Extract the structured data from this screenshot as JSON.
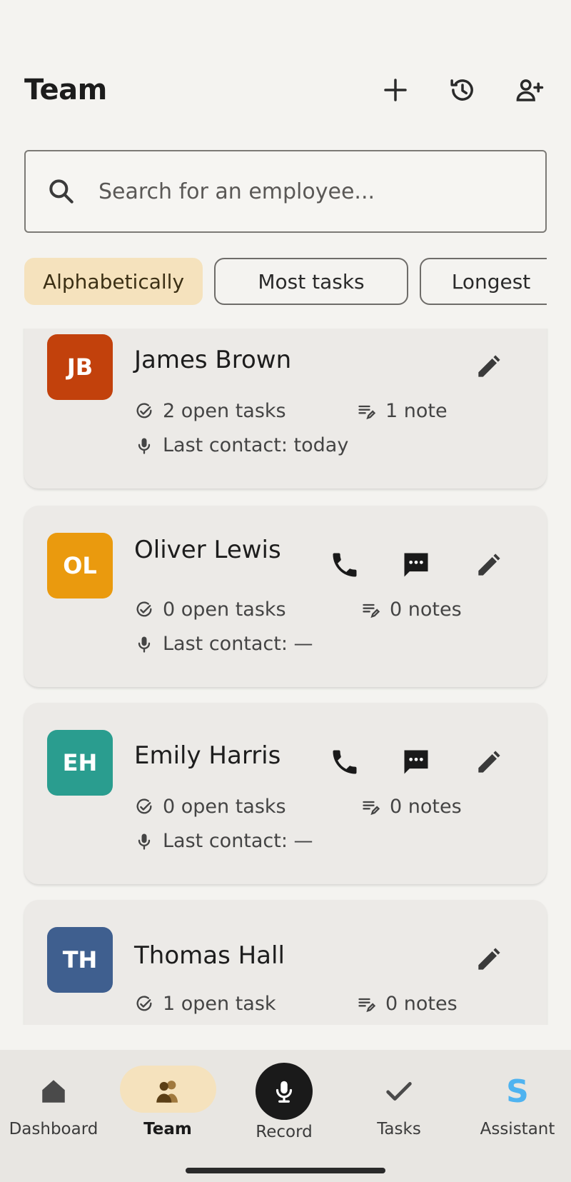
{
  "header": {
    "title": "Team"
  },
  "search": {
    "placeholder": "Search for an employee..."
  },
  "sort_chips": [
    {
      "label": "Alphabetically",
      "active": true
    },
    {
      "label": "Most tasks",
      "active": false
    },
    {
      "label": "Longest",
      "active": false
    }
  ],
  "employees": [
    {
      "initials": "JB",
      "name": "James Brown",
      "color": "#c2410c",
      "tasks": "2 open tasks",
      "notes": "1 note",
      "last_contact": "Last contact: today",
      "can_call": false
    },
    {
      "initials": "OL",
      "name": "Oliver Lewis",
      "color": "#ea9a0e",
      "tasks": "0 open tasks",
      "notes": "0 notes",
      "last_contact": "Last contact: —",
      "can_call": true
    },
    {
      "initials": "EH",
      "name": "Emily Harris",
      "color": "#2a9d8f",
      "tasks": "0 open tasks",
      "notes": "0 notes",
      "last_contact": "Last contact: —",
      "can_call": true
    },
    {
      "initials": "TH",
      "name": "Thomas Hall",
      "color": "#3f5f8f",
      "tasks": "1 open task",
      "notes": "0 notes",
      "last_contact": "",
      "can_call": false
    }
  ],
  "nav": {
    "dashboard": "Dashboard",
    "team": "Team",
    "record": "Record",
    "tasks": "Tasks",
    "assistant": "Assistant",
    "assistant_glyph": "S",
    "active": "team"
  },
  "colors": {
    "accent_chip": "#f5e2bd",
    "assistant": "#4fb3f0"
  }
}
